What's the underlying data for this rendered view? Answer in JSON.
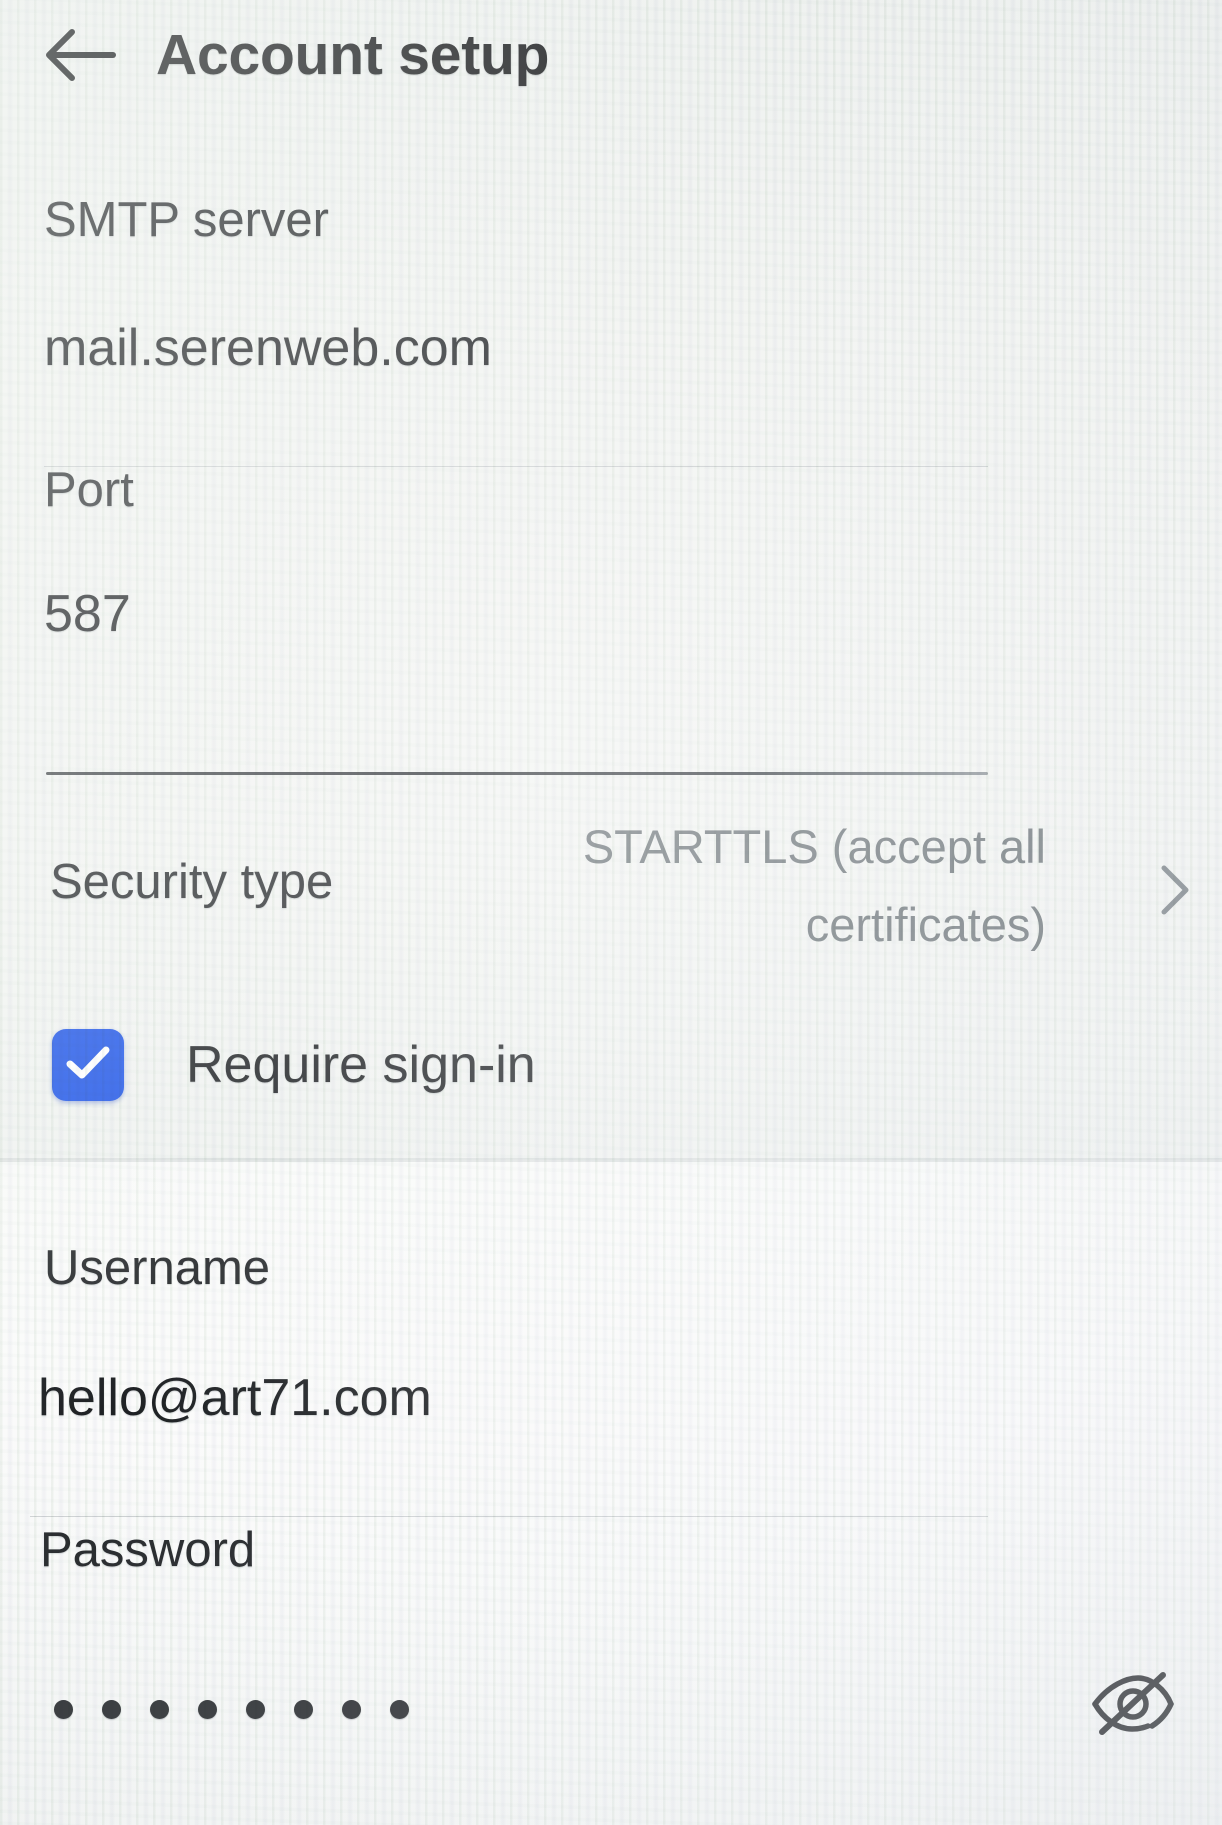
{
  "header": {
    "title": "Account setup",
    "back_icon": "arrow-left-icon"
  },
  "form": {
    "smtp": {
      "label": "SMTP server",
      "value": "mail.serenweb.com"
    },
    "port": {
      "label": "Port",
      "value": "587",
      "focused": true
    },
    "security_type": {
      "label": "Security type",
      "value": "STARTTLS (accept all certificates)",
      "chevron_icon": "chevron-right-icon"
    },
    "require_signin": {
      "label": "Require sign-in",
      "checked": true,
      "check_icon": "checkmark-icon",
      "accent_color": "#1d54e8"
    },
    "username": {
      "label": "Username",
      "value": "hello@art71.com"
    },
    "password": {
      "label": "Password",
      "masked_value": "••••••••",
      "dot_count": 8,
      "toggle_icon": "eye-off-icon"
    }
  }
}
